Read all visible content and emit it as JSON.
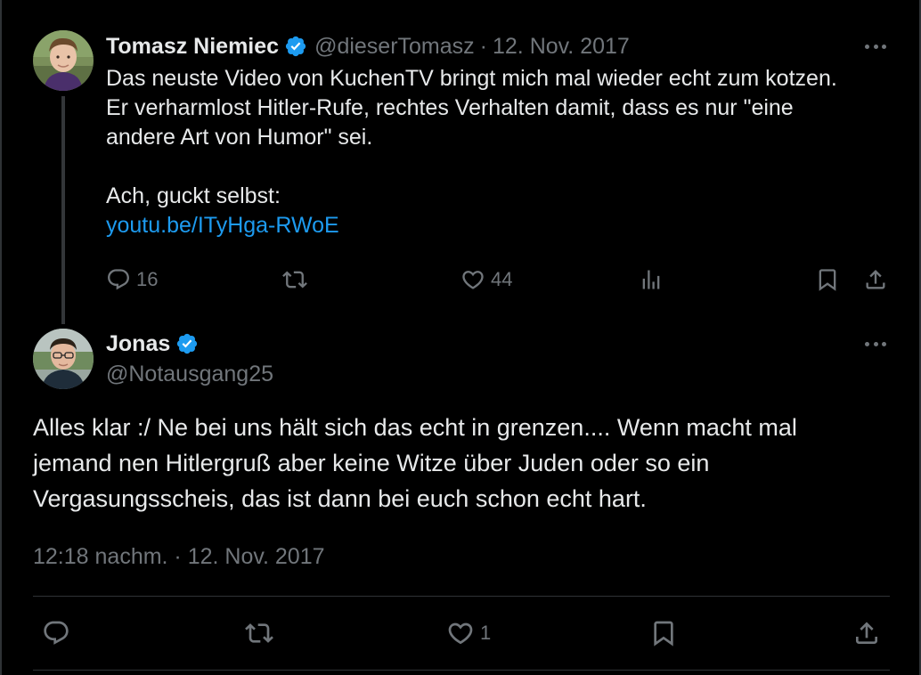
{
  "tweet1": {
    "author_name": "Tomasz Niemiec",
    "handle": "@dieserTomasz",
    "separator": "·",
    "date": "12. Nov. 2017",
    "text_lines": [
      "Das neuste Video von KuchenTV bringt mich mal wieder echt zum kotzen.",
      "Er verharmlost Hitler-Rufe, rechtes Verhalten damit, dass es nur \"eine",
      "andere Art von Humor\" sei."
    ],
    "text2": "Ach, guckt selbst:",
    "link": "youtu.be/ITyHga-RWoE",
    "replies": "16",
    "retweets": "",
    "likes": "44",
    "icons": {
      "reply": "reply-icon",
      "retweet": "retweet-icon",
      "like": "heart-icon",
      "views": "views-chart-icon",
      "bookmark": "bookmark-icon",
      "share": "share-icon",
      "more": "more-icon",
      "verified": "verified-badge-icon"
    }
  },
  "tweet2": {
    "author_name": "Jonas",
    "handle": "@Notausgang25",
    "text_lines": [
      "Alles klar :/ Ne bei uns hält sich das echt in grenzen.... Wenn macht mal",
      "jemand nen Hitlergruß aber keine Witze über Juden oder so ein",
      "Vergasungsscheis, das ist dann bei euch schon echt hart."
    ],
    "timestamp": "12:18 nachm. · 12. Nov. 2017",
    "likes": "1"
  },
  "colors": {
    "background": "#000000",
    "text": "#e7e9ea",
    "muted": "#71767b",
    "link": "#1d9bf0",
    "verified": "#1d9bf0",
    "divider": "#2f3336"
  }
}
